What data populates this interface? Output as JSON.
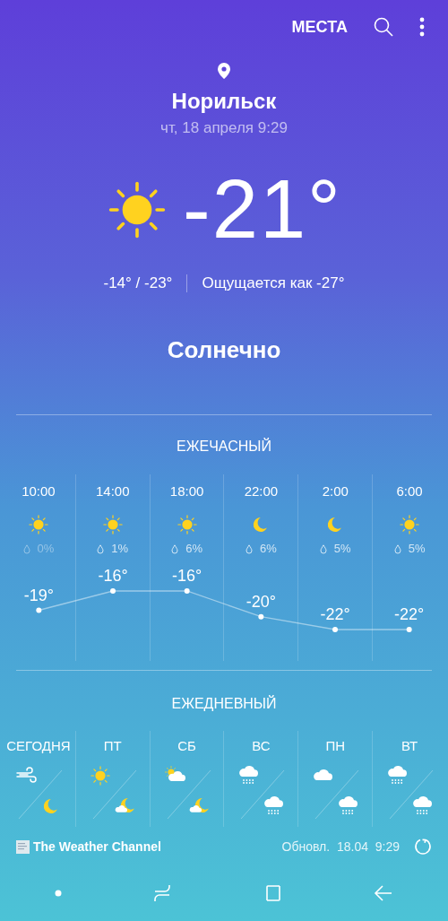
{
  "top_bar": {
    "places_button": "МЕСТА"
  },
  "location": {
    "city": "Норильск",
    "datetime": "чт, 18 апреля 9:29"
  },
  "current": {
    "kind": "sun",
    "temperature": "-21°",
    "high_low": "-14° / -23°",
    "feels_like": "Ощущается как -27°",
    "condition": "Солнечно"
  },
  "hourly": {
    "title": "ЕЖЕЧАСНЫЙ",
    "items": [
      {
        "kind": "sun",
        "precip": "0%",
        "muted": true
      },
      {
        "kind": "sun",
        "precip": "1%",
        "muted": false
      },
      {
        "kind": "sun",
        "precip": "6%",
        "muted": false
      },
      {
        "kind": "moon",
        "precip": "6%",
        "muted": false
      },
      {
        "kind": "moon",
        "precip": "5%",
        "muted": false
      },
      {
        "kind": "sun",
        "precip": "5%",
        "muted": false
      }
    ],
    "chart_data": {
      "type": "line",
      "categories": [
        "10:00",
        "14:00",
        "18:00",
        "22:00",
        "2:00",
        "6:00"
      ],
      "marker": "circle",
      "values": [
        -19,
        -16,
        -16,
        -20,
        -22,
        -22
      ],
      "value_labels": [
        "-19°",
        "-16°",
        "-16°",
        "-20°",
        "-22°",
        "-22°"
      ]
    }
  },
  "daily": {
    "title": "ЕЖЕДНЕВНЫЙ",
    "items": [
      {
        "day": "СЕГОДНЯ",
        "day_icon": {
          "kind": "wind"
        },
        "night_icon": {
          "kind": "moon"
        }
      },
      {
        "day": "ПТ",
        "day_icon": {
          "kind": "sun"
        },
        "night_icon": {
          "kind": "moon-cloud"
        }
      },
      {
        "day": "СБ",
        "day_icon": {
          "kind": "sun-cloud"
        },
        "night_icon": {
          "kind": "moon-cloud"
        }
      },
      {
        "day": "ВС",
        "day_icon": {
          "kind": "snow"
        },
        "night_icon": {
          "kind": "snow"
        }
      },
      {
        "day": "ПН",
        "day_icon": {
          "kind": "cloud"
        },
        "night_icon": {
          "kind": "snow"
        }
      },
      {
        "day": "ВТ",
        "day_icon": {
          "kind": "snow"
        },
        "night_icon": {
          "kind": "snow"
        }
      }
    ]
  },
  "footer": {
    "provider": "The Weather Channel",
    "updated": "Обновл.  18.04  9:29"
  }
}
